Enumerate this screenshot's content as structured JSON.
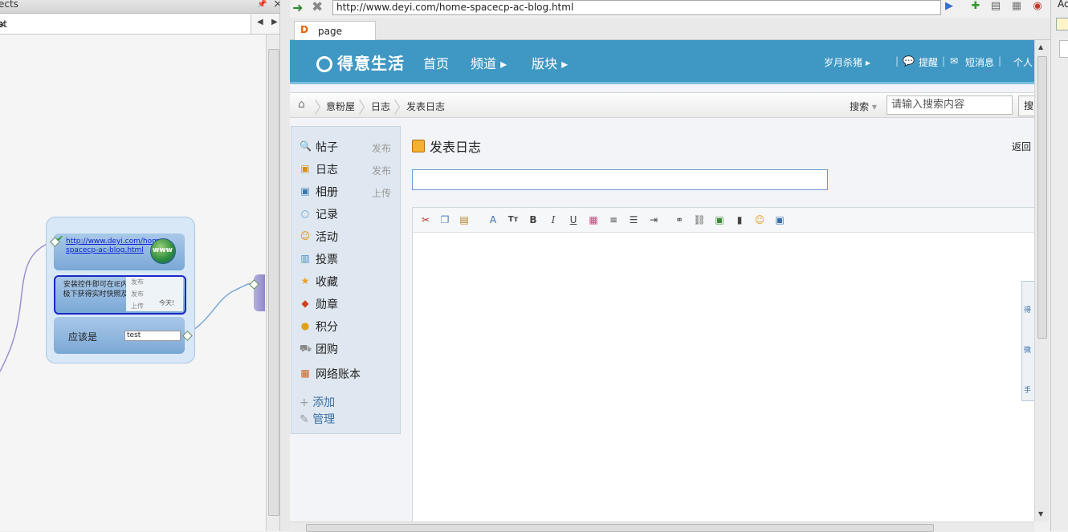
{
  "left_panel": {
    "title": "ects",
    "tab_label": "st",
    "node_url": "http://www.deyi.com/home-spacecp-ac-blog.html",
    "globe_text": "www",
    "node2_text": "安装控件即可在IE内极下获得实时快照及",
    "node2_thumb_items": [
      "发布",
      "发布",
      "上传"
    ],
    "node2_thumb_label": "今天!",
    "node3_label": "应该是",
    "node3_value": "test"
  },
  "browser": {
    "url": "http://www.deyi.com/home-spacecp-ac-blog.html",
    "tab_title": "page",
    "tab_icon_letter": "D"
  },
  "site": {
    "logo": "得意生活",
    "nav": [
      {
        "label": "首页"
      },
      {
        "label": "频道 ▸"
      },
      {
        "label": "版块 ▸"
      }
    ],
    "user": "岁月杀猪 ▸",
    "remind": "提醒",
    "messages": "短消息",
    "personal": "个人",
    "breadcrumb": [
      "意粉屋",
      "日志",
      "发表日志"
    ],
    "search_label": "搜索",
    "search_placeholder": "请输入搜索内容",
    "search_button": "搜",
    "sidebar": [
      {
        "label": "帖子",
        "action": "发布",
        "icon": "post-icon"
      },
      {
        "label": "日志",
        "action": "发布",
        "icon": "blog-icon"
      },
      {
        "label": "相册",
        "action": "上传",
        "icon": "album-icon"
      },
      {
        "label": "记录",
        "action": "",
        "icon": "record-icon"
      },
      {
        "label": "活动",
        "action": "",
        "icon": "activity-icon"
      },
      {
        "label": "投票",
        "action": "",
        "icon": "poll-icon"
      },
      {
        "label": "收藏",
        "action": "",
        "icon": "favorite-icon"
      },
      {
        "label": "勋章",
        "action": "",
        "icon": "medal-icon"
      },
      {
        "label": "积分",
        "action": "",
        "icon": "points-icon"
      },
      {
        "label": "团购",
        "action": "",
        "icon": "groupbuy-icon"
      },
      {
        "label": "网络账本",
        "action": "",
        "icon": "ledger-icon"
      }
    ],
    "add_label": "添加",
    "manage_label": "管理",
    "page_title": "发表日志",
    "back_label": "返回",
    "floatbar": [
      "得",
      "微",
      "手"
    ]
  },
  "right_strip": {
    "title": "Ac"
  }
}
